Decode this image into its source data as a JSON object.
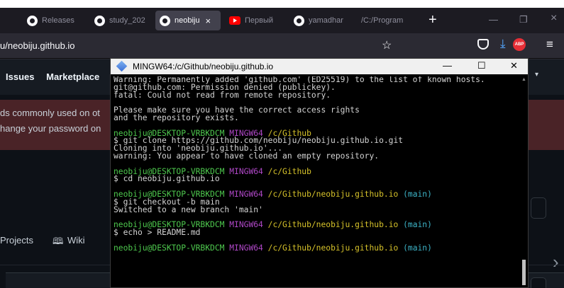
{
  "browser": {
    "tabs": [
      {
        "label": "",
        "icon": "generic-tab-icon"
      },
      {
        "label": "Releases",
        "icon": "github-icon"
      },
      {
        "label": "study_202",
        "icon": "github-icon"
      },
      {
        "label": "neobiju",
        "icon": "github-icon",
        "active": true
      },
      {
        "label": "Первый",
        "icon": "youtube-icon"
      },
      {
        "label": "yamadhar",
        "icon": "github-icon"
      },
      {
        "label": "/C:/Program",
        "icon": ""
      }
    ],
    "close_glyph": "×",
    "new_tab": "+",
    "url": "u/neobiju.github.io",
    "controls": {
      "minimize": "—",
      "restore": "❐",
      "close": "×"
    }
  },
  "github": {
    "nav": [
      "Issues",
      "Marketplace"
    ],
    "banner": [
      "ds commonly used on ot",
      "hange your password on"
    ],
    "tabs": [
      "Projects",
      "Wiki"
    ],
    "wiki_icon": "book-icon"
  },
  "terminal": {
    "title": "MINGW64:/c/Github/neobiju.github.io",
    "controls": {
      "minimize": "—",
      "maximize": "☐",
      "close": "✕"
    },
    "lines": [
      {
        "segs": [
          {
            "t": "Warning: Permanently added 'github.com' (ED25519) to the list of known hosts."
          }
        ]
      },
      {
        "segs": [
          {
            "t": "git@github.com: Permission denied (publickey)."
          }
        ]
      },
      {
        "segs": [
          {
            "t": "fatal: Could not read from remote repository."
          }
        ]
      },
      {
        "blank": true
      },
      {
        "segs": [
          {
            "t": "Please make sure you have the correct access rights"
          }
        ]
      },
      {
        "segs": [
          {
            "t": "and the repository exists."
          }
        ]
      },
      {
        "blank": true
      },
      {
        "segs": [
          {
            "t": "neobiju@DESKTOP-VRBKDCM ",
            "c": "c-green"
          },
          {
            "t": "MINGW64 ",
            "c": "c-m"
          },
          {
            "t": "/c/Github",
            "c": "c-y"
          }
        ]
      },
      {
        "segs": [
          {
            "t": "$ git clone https://github.com/neobiju/neobiju.github.io.git"
          }
        ]
      },
      {
        "segs": [
          {
            "t": "Cloning into 'neobiju.github.io'..."
          }
        ]
      },
      {
        "segs": [
          {
            "t": "warning: You appear to have cloned an empty repository."
          }
        ]
      },
      {
        "blank": true
      },
      {
        "segs": [
          {
            "t": "neobiju@DESKTOP-VRBKDCM ",
            "c": "c-green"
          },
          {
            "t": "MINGW64 ",
            "c": "c-m"
          },
          {
            "t": "/c/Github",
            "c": "c-y"
          }
        ]
      },
      {
        "segs": [
          {
            "t": "$ cd neobiju.github.io"
          }
        ]
      },
      {
        "blank": true
      },
      {
        "segs": [
          {
            "t": "neobiju@DESKTOP-VRBKDCM ",
            "c": "c-green"
          },
          {
            "t": "MINGW64 ",
            "c": "c-m"
          },
          {
            "t": "/c/Github/neobiju.github.io ",
            "c": "c-y"
          },
          {
            "t": "(main)",
            "c": "c-c"
          }
        ]
      },
      {
        "segs": [
          {
            "t": "$ git checkout -b main"
          }
        ]
      },
      {
        "segs": [
          {
            "t": "Switched to a new branch 'main'"
          }
        ]
      },
      {
        "blank": true
      },
      {
        "segs": [
          {
            "t": "neobiju@DESKTOP-VRBKDCM ",
            "c": "c-green"
          },
          {
            "t": "MINGW64 ",
            "c": "c-m"
          },
          {
            "t": "/c/Github/neobiju.github.io ",
            "c": "c-y"
          },
          {
            "t": "(main)",
            "c": "c-c"
          }
        ]
      },
      {
        "segs": [
          {
            "t": "$ echo > README.md"
          }
        ]
      },
      {
        "blank": true
      },
      {
        "segs": [
          {
            "t": "neobiju@DESKTOP-VRBKDCM ",
            "c": "c-green"
          },
          {
            "t": "MINGW64 ",
            "c": "c-m"
          },
          {
            "t": "/c/Github/neobiju.github.io ",
            "c": "c-y"
          },
          {
            "t": "(main)",
            "c": "c-c"
          }
        ]
      }
    ]
  },
  "colors": {
    "terminal_bg": "#000000",
    "prompt_user": "#4ec94e",
    "prompt_mingw": "#b048c8",
    "prompt_path": "#d6c22a",
    "prompt_branch": "#3db4c8",
    "browser_bg": "#1c1b22",
    "banner_bg": "#4a2327"
  }
}
